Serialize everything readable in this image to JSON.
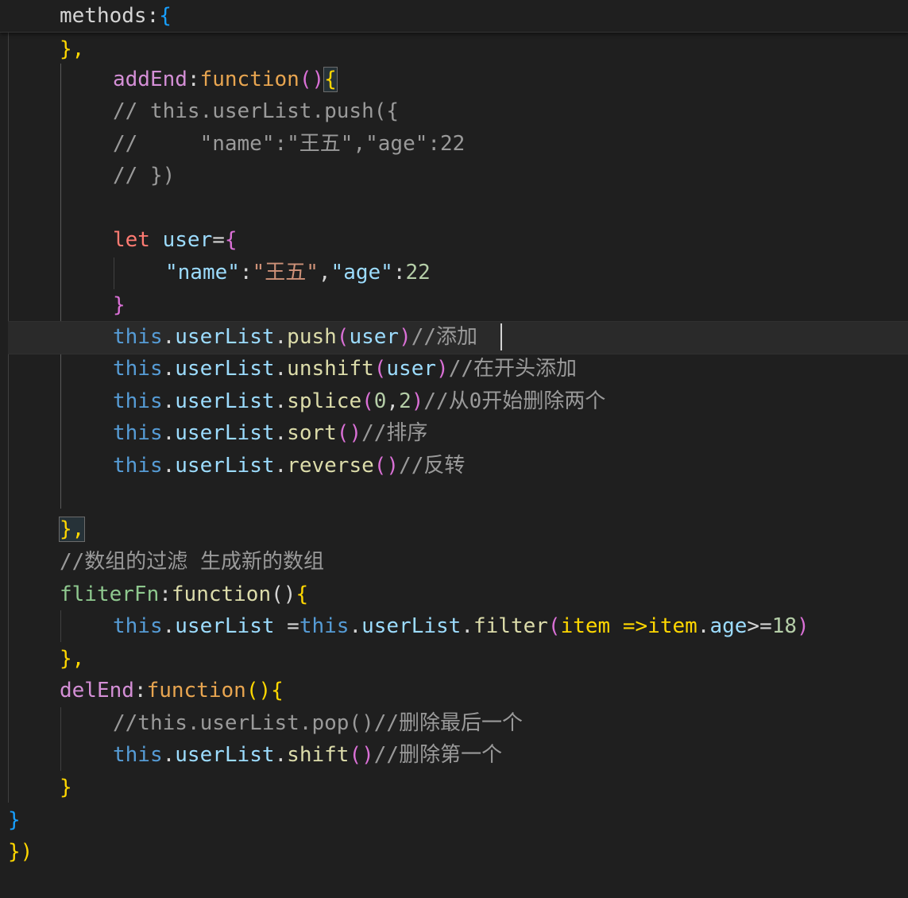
{
  "editor": {
    "sticky_line": {
      "key": "methods",
      "colon": ":",
      "brace": "{"
    },
    "lines": [
      {
        "id": "l1",
        "text": "},"
      },
      {
        "id": "l2",
        "name": "addEnd",
        "colon": ":",
        "kw": "function",
        "paren": "()",
        "brace": "{"
      },
      {
        "id": "l3",
        "text": "// this.userList.push({"
      },
      {
        "id": "l4",
        "text": "//     \"name\":\"王五\",\"age\":22"
      },
      {
        "id": "l5",
        "text": "// })"
      },
      {
        "id": "l6",
        "kw": "let",
        "var": "user",
        "eq": "=",
        "brace": "{"
      },
      {
        "id": "l7",
        "k1": "\"name\"",
        "colon": ":",
        "v1": "\"王五\"",
        "comma": ",",
        "k2": "\"age\"",
        "colon2": ":",
        "v2": "22"
      },
      {
        "id": "l8",
        "text": "}"
      },
      {
        "id": "l9",
        "obj": "this",
        "dot": ".",
        "prop": "userList",
        "dot2": ".",
        "method": "push",
        "open": "(",
        "arg": "user",
        "close": ")",
        "comment": "//添加"
      },
      {
        "id": "l10",
        "obj": "this",
        "dot": ".",
        "prop": "userList",
        "dot2": ".",
        "method": "unshift",
        "open": "(",
        "arg": "user",
        "close": ")",
        "comment": "//在开头添加"
      },
      {
        "id": "l11",
        "obj": "this",
        "dot": ".",
        "prop": "userList",
        "dot2": ".",
        "method": "splice",
        "open": "(",
        "arg1": "0",
        "comma": ",",
        "arg2": "2",
        "close": ")",
        "comment": "//从0开始删除两个"
      },
      {
        "id": "l12",
        "obj": "this",
        "dot": ".",
        "prop": "userList",
        "dot2": ".",
        "method": "sort",
        "open": "(",
        "close": ")",
        "comment": "//排序"
      },
      {
        "id": "l13",
        "obj": "this",
        "dot": ".",
        "prop": "userList",
        "dot2": ".",
        "method": "reverse",
        "open": "(",
        "close": ")",
        "comment": "//反转"
      },
      {
        "id": "l14",
        "text": "},"
      },
      {
        "id": "l15",
        "text": "//数组的过滤 生成新的数组"
      },
      {
        "id": "l16",
        "name": "fliterFn",
        "colon": ":",
        "kw": "function",
        "paren": "()",
        "brace": "{"
      },
      {
        "id": "l17",
        "obj": "this",
        "dot": ".",
        "prop": "userList ",
        "eq": "=",
        "obj2": "this",
        "dot2": ".",
        "prop2": "userList",
        "dot3": ".",
        "method": "filter",
        "open": "(",
        "param": "item",
        "arrow": " =>",
        "param2": "item",
        "dot4": ".",
        "prop3": "age",
        "cmp": ">=",
        "num": "18",
        "close": ")"
      },
      {
        "id": "l18",
        "text": "},"
      },
      {
        "id": "l19",
        "name": "delEnd",
        "colon": ":",
        "kw": "function",
        "paren": "()",
        "brace": "{"
      },
      {
        "id": "l20",
        "text": "//this.userList.pop()//删除最后一个"
      },
      {
        "id": "l21",
        "obj": "this",
        "dot": ".",
        "prop": "userList",
        "dot2": ".",
        "method": "shift",
        "open": "(",
        "close": ")",
        "comment": "//删除第一个"
      },
      {
        "id": "l22",
        "text": "}"
      },
      {
        "id": "l23",
        "text": "}"
      },
      {
        "id": "l24",
        "text": "})"
      }
    ],
    "colors": {
      "background": "#1f1f1f",
      "this": "#569cd6",
      "property": "#9cdcfe",
      "function": "#dcdcaa",
      "string": "#ce9178",
      "number": "#b5cea8",
      "comment": "#9a9a9a"
    }
  }
}
